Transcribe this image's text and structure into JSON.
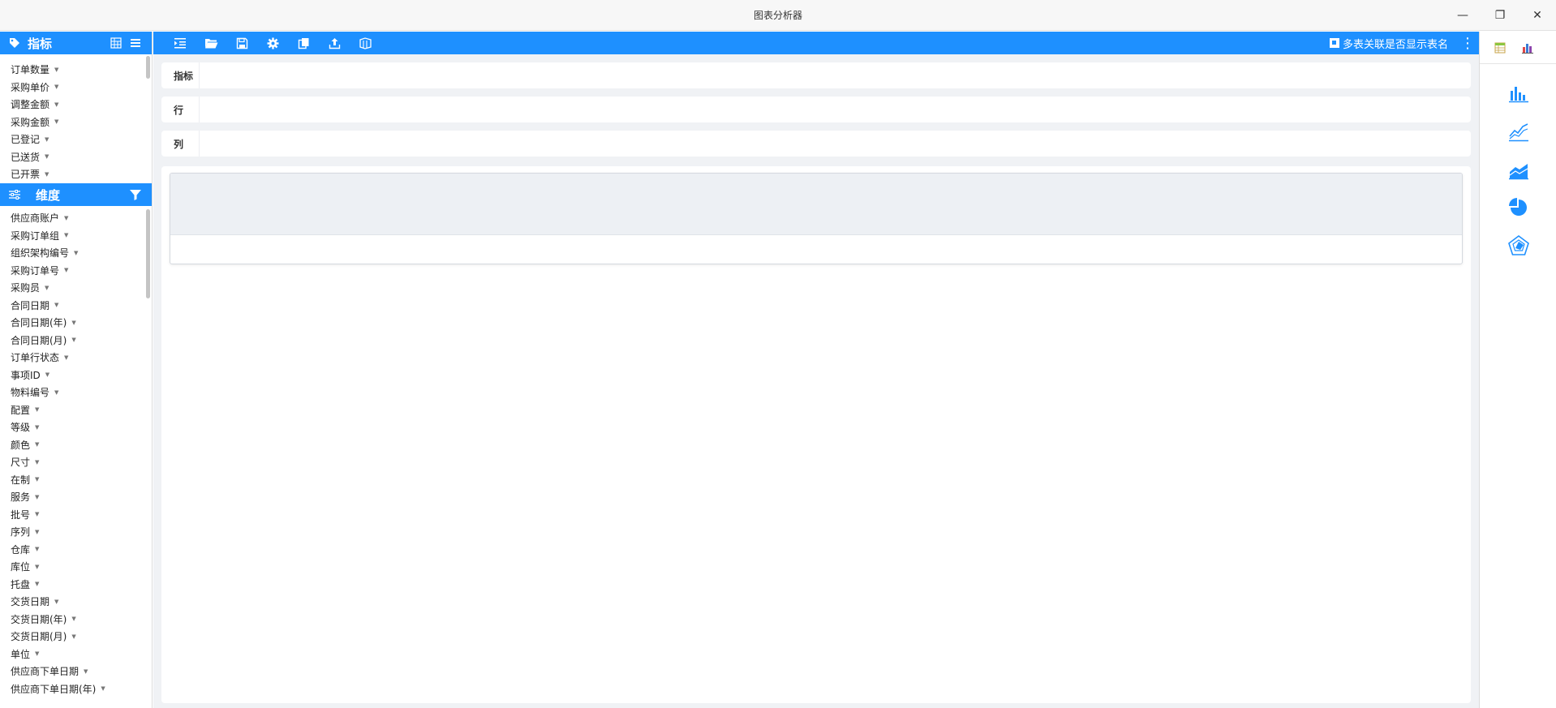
{
  "window": {
    "title": "图表分析器",
    "minimize_glyph": "—",
    "restore_glyph": "❐",
    "close_glyph": "✕"
  },
  "measures_panel": {
    "title": "指标",
    "icon": "tag-icon",
    "items": [
      "订单数量",
      "采购单价",
      "调整金额",
      "采购金额",
      "已登记",
      "已送货",
      "已开票"
    ]
  },
  "dimensions_panel": {
    "title": "维度",
    "icon": "sliders-icon",
    "items": [
      "供应商账户",
      "采购订单组",
      "组织架构编号",
      "采购订单号",
      "采购员",
      "合同日期",
      "合同日期(年)",
      "合同日期(月)",
      "订单行状态",
      "事项ID",
      "物料编号",
      "配置",
      "等级",
      "颜色",
      "尺寸",
      "在制",
      "服务",
      "批号",
      "序列",
      "仓库",
      "库位",
      "托盘",
      "交货日期",
      "交货日期(年)",
      "交货日期(月)",
      "单位",
      "供应商下单日期",
      "供应商下单日期(年)"
    ]
  },
  "toolbar": {
    "checkbox_label": "多表关联是否显示表名",
    "more_glyph": "⋮"
  },
  "dropzones": {
    "measures_label": "指标",
    "rows_label": "行",
    "columns_label": "列"
  },
  "colors": {
    "accent": "#1e90ff",
    "background": "#f0f2f5"
  }
}
